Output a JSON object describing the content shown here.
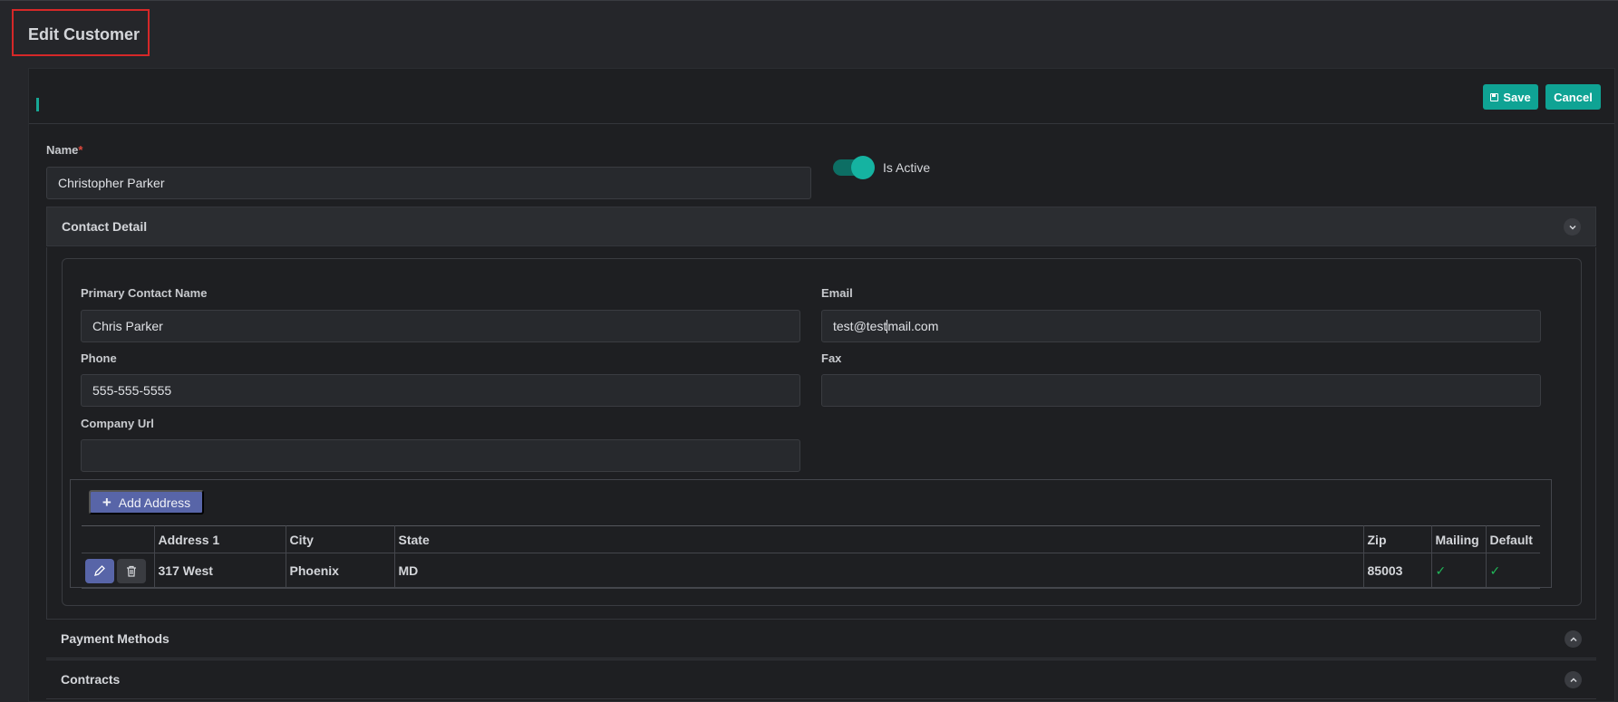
{
  "page": {
    "title": "Edit Customer"
  },
  "toolbar": {
    "save_label": "Save",
    "cancel_label": "Cancel"
  },
  "form": {
    "name_label": "Name",
    "required_mark": "*",
    "name_value": "Christopher Parker",
    "active_label": "Is Active",
    "active_on": true
  },
  "contact": {
    "title": "Contact Detail",
    "primary_label": "Primary Contact Name",
    "primary_value": "Chris Parker",
    "email_label": "Email",
    "email_value_before": "test@test",
    "email_value_after": "mail.com",
    "phone_label": "Phone",
    "phone_value": "555-555-5555",
    "fax_label": "Fax",
    "fax_value": "",
    "url_label": "Company Url",
    "url_value": ""
  },
  "addresses": {
    "add_label": "Add Address",
    "columns": [
      "",
      "Address 1",
      "City",
      "State",
      "Zip",
      "Mailing",
      "Default"
    ],
    "rows": [
      {
        "address1": "317 West",
        "city": "Phoenix",
        "state": "MD",
        "zip": "85003",
        "mailing": "✓",
        "default": "✓"
      }
    ]
  },
  "sections": {
    "payment_title": "Payment Methods",
    "contracts_title": "Contracts"
  },
  "colors": {
    "accent": "#0fa394",
    "primary_button": "#5865a8",
    "required": "#e0483c",
    "check": "#20b858"
  },
  "icons": [
    "save-icon",
    "chevron-down-icon",
    "chevron-up-icon",
    "plus-icon",
    "pencil-icon",
    "trash-icon"
  ]
}
